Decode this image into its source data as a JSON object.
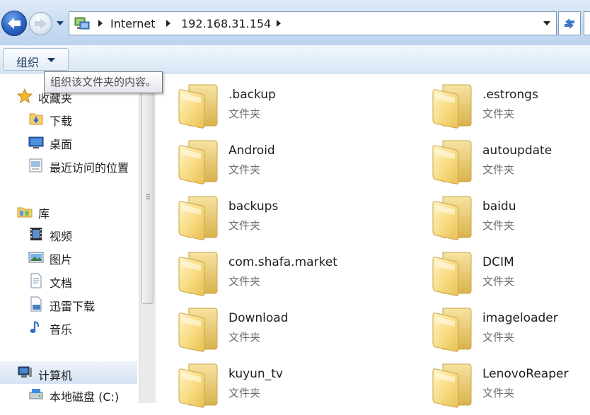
{
  "address_bar": {
    "segments": [
      "Internet",
      "192.168.31.154"
    ]
  },
  "command_bar": {
    "organize_label": "组织"
  },
  "tooltip": {
    "text": "组织该文件夹的内容。"
  },
  "sidebar": {
    "favorites": {
      "label": "收藏夹",
      "items": [
        {
          "label": "下载",
          "icon": "downloads-folder-icon"
        },
        {
          "label": "桌面",
          "icon": "desktop-icon"
        },
        {
          "label": "最近访问的位置",
          "icon": "recent-places-icon"
        }
      ]
    },
    "libraries": {
      "label": "库",
      "items": [
        {
          "label": "视频",
          "icon": "videos-icon"
        },
        {
          "label": "图片",
          "icon": "pictures-icon"
        },
        {
          "label": "文档",
          "icon": "documents-icon"
        },
        {
          "label": "迅雷下载",
          "icon": "xunlei-downloads-icon"
        },
        {
          "label": "音乐",
          "icon": "music-icon"
        }
      ]
    },
    "computer": {
      "label": "计算机",
      "items": [
        {
          "label": "本地磁盘 (C:)",
          "icon": "local-disk-icon"
        }
      ]
    }
  },
  "folders": [
    {
      "name": ".backup",
      "type": "文件夹"
    },
    {
      "name": ".estrongs",
      "type": "文件夹"
    },
    {
      "name": "Android",
      "type": "文件夹"
    },
    {
      "name": "autoupdate",
      "type": "文件夹"
    },
    {
      "name": "backups",
      "type": "文件夹"
    },
    {
      "name": "baidu",
      "type": "文件夹"
    },
    {
      "name": "com.shafa.market",
      "type": "文件夹"
    },
    {
      "name": "DCIM",
      "type": "文件夹"
    },
    {
      "name": "Download",
      "type": "文件夹"
    },
    {
      "name": "imageloader",
      "type": "文件夹"
    },
    {
      "name": "kuyun_tv",
      "type": "文件夹"
    },
    {
      "name": "LenovoReaper",
      "type": "文件夹"
    }
  ],
  "colors": {
    "folder": "#f4d57a",
    "titlebar": "#c9dcf2",
    "selection": "#d6e3f3"
  }
}
